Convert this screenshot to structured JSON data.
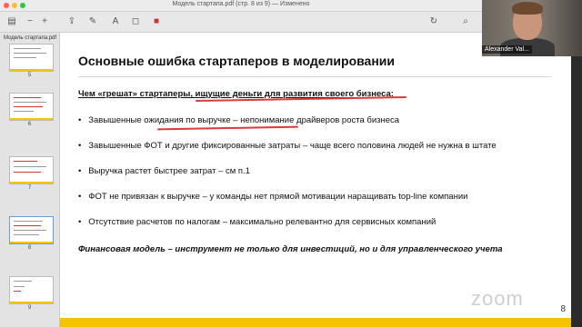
{
  "window": {
    "title": "Модель стартапа.pdf (стр. 8 из 9) — Изменено",
    "traffic_lights": [
      "#ff5f57",
      "#febc2e",
      "#28c840"
    ]
  },
  "toolbar": {
    "icons": [
      "sidebar-icon",
      "zoom-out-icon",
      "zoom-in-icon",
      "share-icon",
      "markup-icon",
      "text-icon",
      "shapes-icon",
      "color-icon",
      "rotate-icon",
      "search-icon"
    ]
  },
  "sidebar": {
    "title": "Модель стартапа.pdf",
    "pages": [
      "5",
      "6",
      "7",
      "8",
      "9"
    ]
  },
  "slide": {
    "title": "Основные ошибка стартаперов в моделировании",
    "subhead": "Чем «грешат» стартаперы, ищущие деньги для развития своего бизнеса:",
    "bullets": [
      "Завышенные ожидания по выручке – непонимание драйверов роста бизнеса",
      "Завышенные ФОТ и другие фиксированные затраты – чаще всего половина людей не нужна в штате",
      "Выручка растет быстрее затрат – см п.1",
      "ФОТ не привязан к выручке – у команды нет прямой мотивации наращивать top-line компании",
      "Отсутствие расчетов по налогам – максимально релевантно для сервисных компаний"
    ],
    "conclusion": "Финансовая модель – инструмент не только для инвестиций, но и для управленческого учета",
    "page_number": "8",
    "watermark": "zoom"
  },
  "video": {
    "participant": "Alexander Val..."
  },
  "colors": {
    "accent": "#f4c400",
    "annotation": "#d93a3a"
  }
}
